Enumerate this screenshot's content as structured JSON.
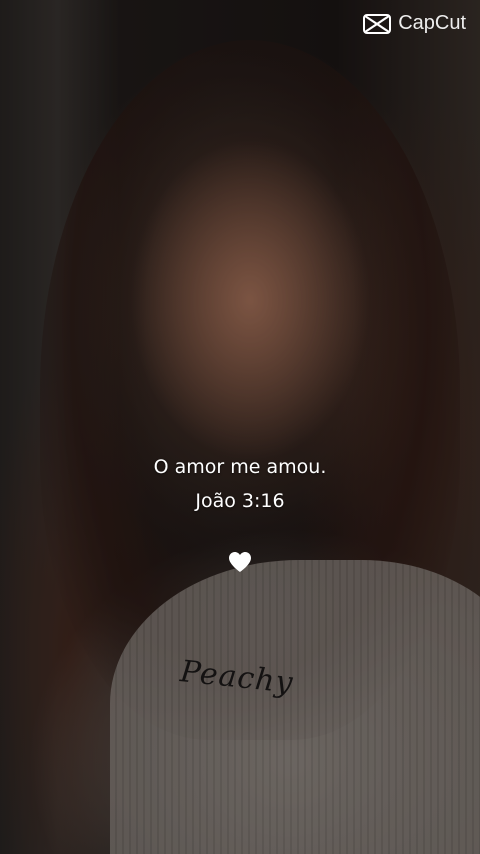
{
  "watermark": {
    "brand": "CapCut",
    "icon": "capcut-logo-icon"
  },
  "overlay": {
    "line1": "O amor me amou.",
    "line2": "João 3:16",
    "emoji": "white-heart-icon"
  },
  "shirt": {
    "print": "Peachy"
  }
}
